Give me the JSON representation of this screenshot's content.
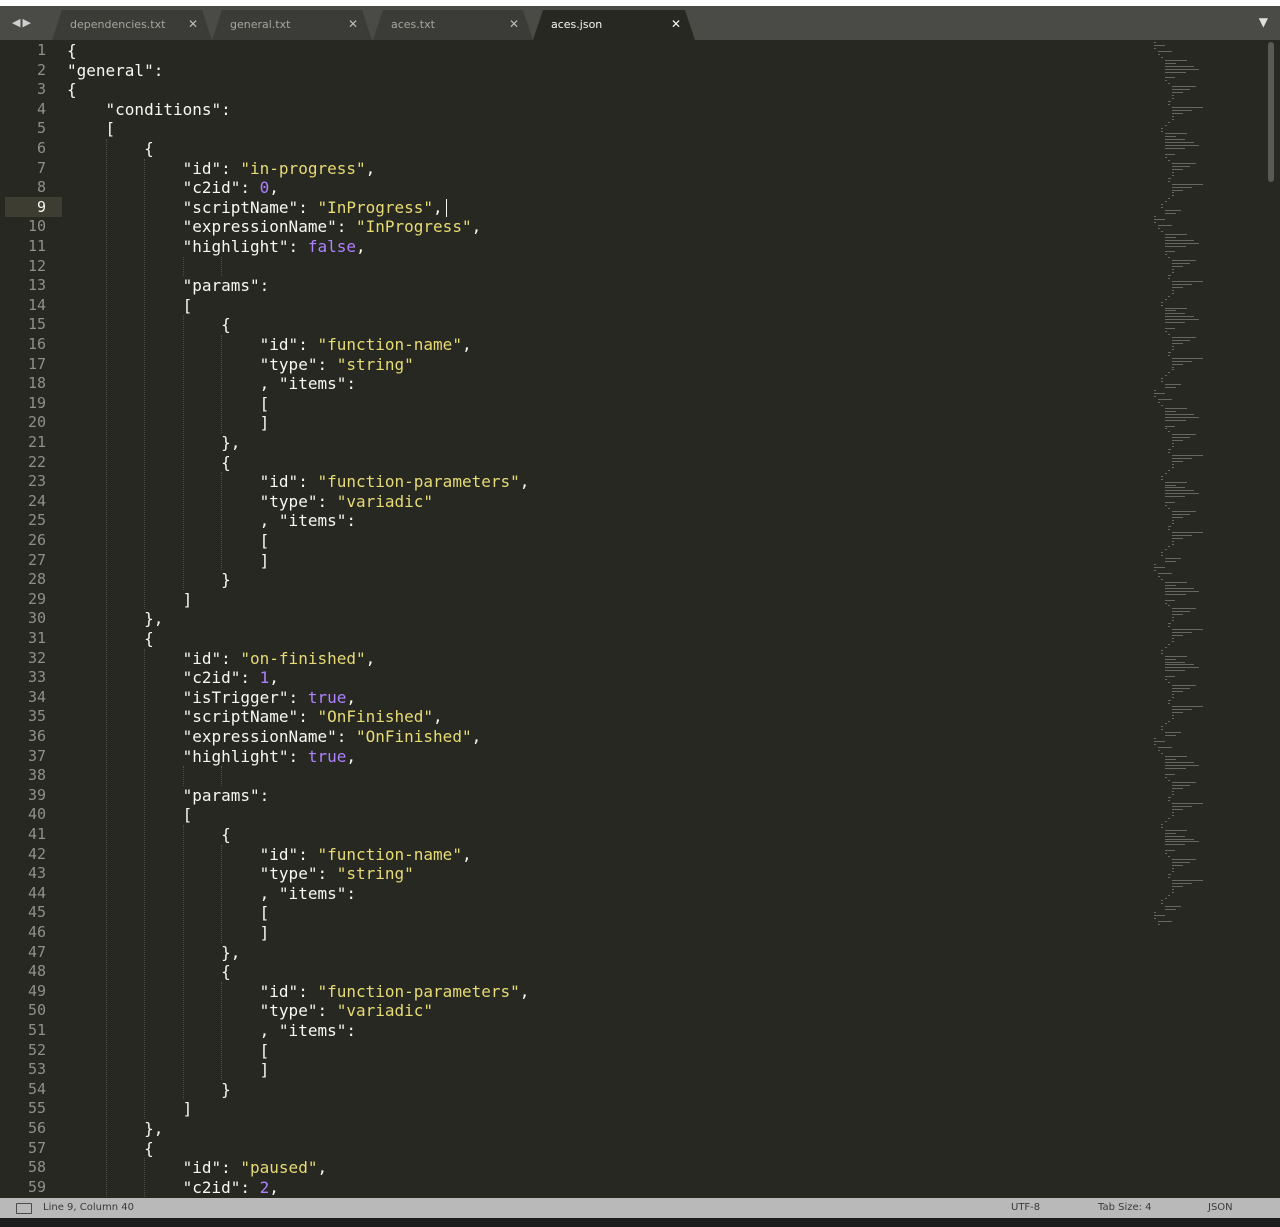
{
  "tabs": [
    {
      "label": "dependencies.txt",
      "active": false
    },
    {
      "label": "general.txt",
      "active": false
    },
    {
      "label": "aces.txt",
      "active": false
    },
    {
      "label": "aces.json",
      "active": true
    }
  ],
  "icons": {
    "nav": "tab-nav-arrows-icon",
    "dropdown": "tab-list-dropdown-icon",
    "close": "close-icon",
    "panel": "show-panel-icon"
  },
  "colors": {
    "background": "#272822",
    "text": "#f8f8f2",
    "string": "#e6db74",
    "constant": "#ae81ff",
    "line_number": "#8f908a",
    "status_bar": "#b9b9b9"
  },
  "editor": {
    "current_line": 9,
    "lines": [
      "{",
      "\"general\":",
      "{",
      "    \"conditions\":",
      "    [",
      "        {",
      "            \"id\": \"in-progress\",",
      "            \"c2id\": 0,",
      "            \"scriptName\": \"InProgress\",",
      "            \"expressionName\": \"InProgress\",",
      "            \"highlight\": false,",
      "",
      "            \"params\":",
      "            [",
      "                {",
      "                    \"id\": \"function-name\",",
      "                    \"type\": \"string\"",
      "                    , \"items\":",
      "                    [",
      "                    ]",
      "                },",
      "                {",
      "                    \"id\": \"function-parameters\",",
      "                    \"type\": \"variadic\"",
      "                    , \"items\":",
      "                    [",
      "                    ]",
      "                }",
      "            ]",
      "        },",
      "        {",
      "            \"id\": \"on-finished\",",
      "            \"c2id\": 1,",
      "            \"isTrigger\": true,",
      "            \"scriptName\": \"OnFinished\",",
      "            \"expressionName\": \"OnFinished\",",
      "            \"highlight\": true,",
      "",
      "            \"params\":",
      "            [",
      "                {",
      "                    \"id\": \"function-name\",",
      "                    \"type\": \"string\"",
      "                    , \"items\":",
      "                    [",
      "                    ]",
      "                },",
      "                {",
      "                    \"id\": \"function-parameters\",",
      "                    \"type\": \"variadic\"",
      "                    , \"items\":",
      "                    [",
      "                    ]",
      "                }",
      "            ]",
      "        },",
      "        {",
      "            \"id\": \"paused\",",
      "            \"c2id\": 2,"
    ]
  },
  "status_bar": {
    "position": "Line 9, Column 40",
    "encoding": "UTF-8",
    "tab_size": "Tab Size: 4",
    "syntax": "JSON"
  }
}
